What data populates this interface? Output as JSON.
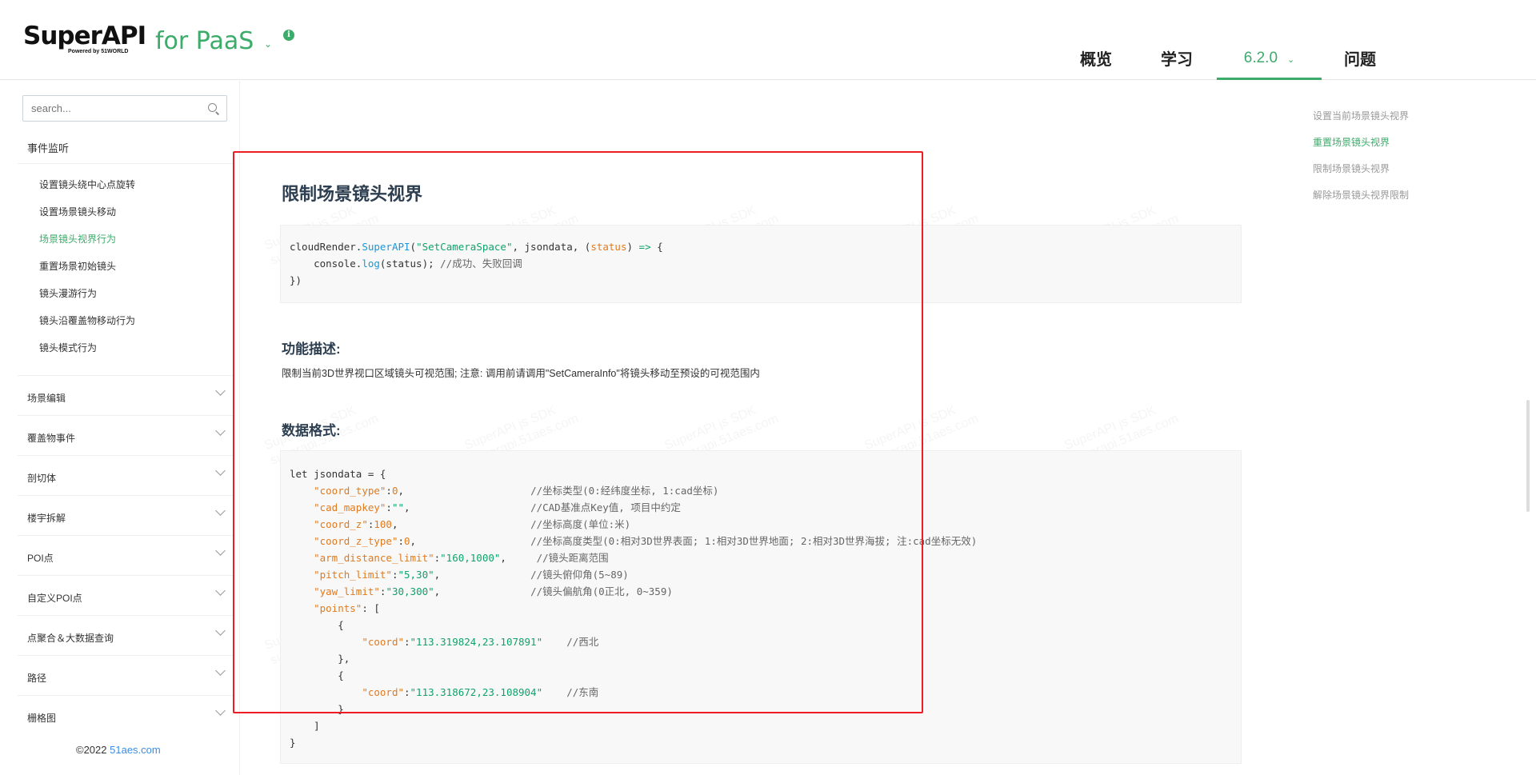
{
  "header": {
    "logo_text": "SuperAPI",
    "logo_sub": "Powered by 51WORLD",
    "product": "for PaaS",
    "product_chevron": "⌄",
    "info_glyph": "i",
    "nav": [
      {
        "label": "概览"
      },
      {
        "label": "学习"
      },
      {
        "label": "6.2.0"
      },
      {
        "label": "问题"
      }
    ],
    "version_chevron": "⌄"
  },
  "sidebar": {
    "search_placeholder": "search...",
    "group_title": "事件监听",
    "sub_items": [
      "设置镜头绕中心点旋转",
      "设置场景镜头移动",
      "场景镜头视界行为",
      "重置场景初始镜头",
      "镜头漫游行为",
      "镜头沿覆盖物移动行为",
      "镜头模式行为"
    ],
    "active_sub_index": 2,
    "categories": [
      "场景编辑",
      "覆盖物事件",
      "剖切体",
      "楼宇拆解",
      "POI点",
      "自定义POI点",
      "点聚合＆大数据查询",
      "路径",
      "栅格图"
    ],
    "copyright_prefix": "©2022 ",
    "copyright_link": "51aes.com"
  },
  "content": {
    "title": "限制场景镜头视界",
    "code1": {
      "l1_a": "cloudRender.",
      "l1_b": "SuperAPI",
      "l1_c": "(",
      "l1_d": "\"SetCameraSpace\"",
      "l1_e": ", jsondata, (",
      "l1_f": "status",
      "l1_g": ") ",
      "l1_h": "=>",
      "l1_i": " {",
      "l2_a": "    console.",
      "l2_b": "log",
      "l2_c": "(status); ",
      "l2_d": "//成功、失败回调",
      "l3": "})"
    },
    "func_heading": "功能描述:",
    "func_desc": "限制当前3D世界视口区域镜头可视范围; 注意: 调用前请调用\"SetCameraInfo\"将镜头移动至预设的可视范围内",
    "data_heading": "数据格式:",
    "code2": {
      "l1": "let jsondata = {",
      "rows": [
        {
          "key": "\"coord_type\"",
          "sep": ":",
          "val": "0",
          "tail": ",",
          "pad": "                     ",
          "comment": "//坐标类型(0:经纬度坐标, 1:cad坐标)",
          "vtype": "num"
        },
        {
          "key": "\"cad_mapkey\"",
          "sep": ":",
          "val": "\"\"",
          "tail": ",",
          "pad": "                    ",
          "comment": "//CAD基准点Key值, 项目中约定",
          "vtype": "str"
        },
        {
          "key": "\"coord_z\"",
          "sep": ":",
          "val": "100",
          "tail": ",",
          "pad": "                      ",
          "comment": "//坐标高度(单位:米)",
          "vtype": "num"
        },
        {
          "key": "\"coord_z_type\"",
          "sep": ":",
          "val": "0",
          "tail": ",",
          "pad": "                   ",
          "comment": "//坐标高度类型(0:相对3D世界表面; 1:相对3D世界地面; 2:相对3D世界海拔; 注:cad坐标无效)",
          "vtype": "num"
        },
        {
          "key": "\"arm_distance_limit\"",
          "sep": ":",
          "val": "\"160,1000\"",
          "tail": ",",
          "pad": "     ",
          "comment": "//镜头距离范围",
          "vtype": "str"
        },
        {
          "key": "\"pitch_limit\"",
          "sep": ":",
          "val": "\"5,30\"",
          "tail": ",",
          "pad": "               ",
          "comment": "//镜头俯仰角(5~89)",
          "vtype": "str"
        },
        {
          "key": "\"yaw_limit\"",
          "sep": ":",
          "val": "\"30,300\"",
          "tail": ",",
          "pad": "               ",
          "comment": "//镜头偏航角(0正北, 0~359)",
          "vtype": "str"
        }
      ],
      "points_key": "\"points\"",
      "points_open": ": [",
      "open_brace": "{",
      "close_brace_comma": "},",
      "close_brace": "}",
      "coord_key": "\"coord\"",
      "coord1": "\"113.319824,23.107891\"",
      "coord1_comment": "//西北",
      "coord2": "\"113.318672,23.108904\"",
      "coord2_comment": "//东南",
      "close_bracket": "]",
      "end": "}"
    }
  },
  "toc": [
    "设置当前场景镜头视界",
    "重置场景镜头视界",
    "限制场景镜头视界",
    "解除场景镜头视界限制"
  ],
  "toc_active_index": 1,
  "colors": {
    "brand": "#3dab6a",
    "annotation": "#ee1c25",
    "link": "#3a8ee6"
  }
}
